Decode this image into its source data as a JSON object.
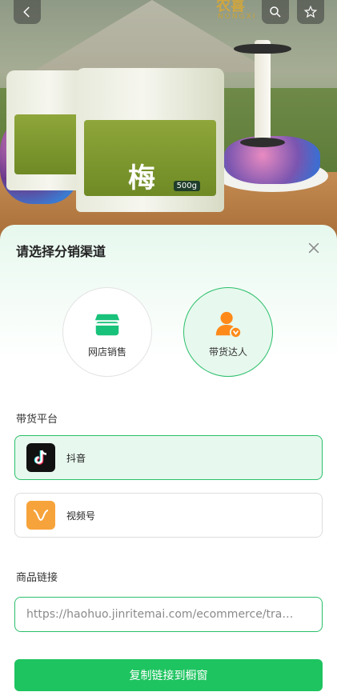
{
  "header": {
    "brand_name": "农喜",
    "brand_sub": "NONGXI",
    "back_icon": "chevron-left-icon",
    "search_icon": "search-icon",
    "favorite_icon": "star-icon"
  },
  "product_image": {
    "jar_main_char": "梅",
    "jar_weight": "500g"
  },
  "sheet": {
    "title": "请选择分销渠道",
    "close_icon": "close-icon",
    "channels": [
      {
        "label": "网店销售",
        "icon": "storefront-icon",
        "selected": false
      },
      {
        "label": "带货达人",
        "icon": "influencer-icon",
        "selected": true
      }
    ],
    "platform_section_label": "带货平台",
    "platforms": [
      {
        "name": "抖音",
        "icon": "douyin-icon",
        "selected": true
      },
      {
        "name": "视频号",
        "icon": "channels-icon",
        "selected": false
      }
    ],
    "link_section_label": "商品链接",
    "link_value": "https://haohuo.jinritemai.com/ecommerce/tra…",
    "copy_button_label": "复制链接到橱窗",
    "accent_color": "#1ec460"
  }
}
